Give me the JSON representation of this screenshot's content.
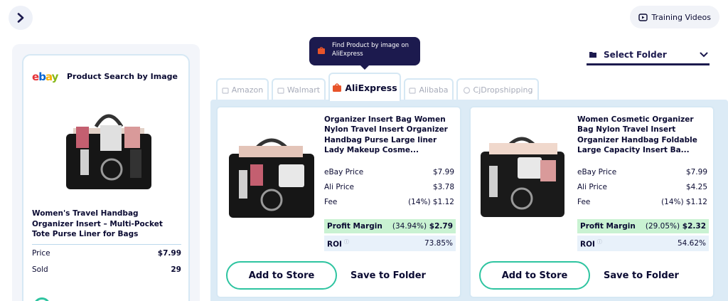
{
  "header": {
    "training_label": "Training Videos"
  },
  "search_card": {
    "title": "Product Search by Image",
    "product_name": "Women's Travel Handbag Organizer Insert – Multi-Pocket Tote Purse Liner for Bags",
    "price_label": "Price",
    "price_value": "$7.99",
    "sold_label": "Sold",
    "sold_value": "29"
  },
  "tooltip": {
    "text": "Find Product by image on AliExpress"
  },
  "folder_select": {
    "label": "Select Folder"
  },
  "tabs": [
    {
      "label": "Amazon",
      "active": false
    },
    {
      "label": "Walmart",
      "active": false
    },
    {
      "label": "AliExpress",
      "active": true
    },
    {
      "label": "Alibaba",
      "active": false
    },
    {
      "label": "CjDropshipping",
      "active": false
    }
  ],
  "results": [
    {
      "title": "Organizer Insert Bag Women Nylon Travel Insert Organizer Handbag Purse Large liner Lady Makeup Cosme...",
      "ebay_price_label": "eBay Price",
      "ebay_price": "$7.99",
      "ali_price_label": "Ali Price",
      "ali_price": "$3.78",
      "fee_label": "Fee",
      "fee": "(14%) $1.12",
      "profit_label": "Profit Margin",
      "profit_pct": "(34.94%)",
      "profit_value": "$2.79",
      "roi_label": "ROI",
      "roi_value": "73.85%",
      "add_label": "Add to Store",
      "save_label": "Save to Folder"
    },
    {
      "title": "Women Cosmetic Organizer Bag Nylon Travel Insert Organizer Handbag Foldable Large Capacity Insert Ba...",
      "ebay_price_label": "eBay Price",
      "ebay_price": "$7.99",
      "ali_price_label": "Ali Price",
      "ali_price": "$4.25",
      "fee_label": "Fee",
      "fee": "(14%) $1.12",
      "profit_label": "Profit Margin",
      "profit_pct": "(29.05%)",
      "profit_value": "$2.32",
      "roi_label": "ROI",
      "roi_value": "54.62%",
      "add_label": "Add to Store",
      "save_label": "Save to Folder"
    }
  ],
  "colors": {
    "navy": "#1c1a4e",
    "teal": "#2ec4a0",
    "profit_bg": "#c9f2d2",
    "panel_bg": "#dcebf6"
  }
}
